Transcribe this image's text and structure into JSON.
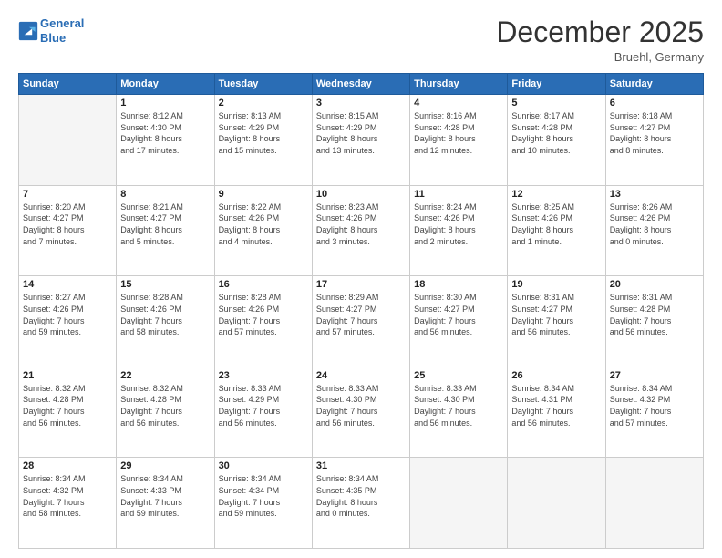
{
  "header": {
    "logo_line1": "General",
    "logo_line2": "Blue",
    "month_year": "December 2025",
    "location": "Bruehl, Germany"
  },
  "days_of_week": [
    "Sunday",
    "Monday",
    "Tuesday",
    "Wednesday",
    "Thursday",
    "Friday",
    "Saturday"
  ],
  "weeks": [
    [
      {
        "day": "",
        "info": ""
      },
      {
        "day": "1",
        "info": "Sunrise: 8:12 AM\nSunset: 4:30 PM\nDaylight: 8 hours\nand 17 minutes."
      },
      {
        "day": "2",
        "info": "Sunrise: 8:13 AM\nSunset: 4:29 PM\nDaylight: 8 hours\nand 15 minutes."
      },
      {
        "day": "3",
        "info": "Sunrise: 8:15 AM\nSunset: 4:29 PM\nDaylight: 8 hours\nand 13 minutes."
      },
      {
        "day": "4",
        "info": "Sunrise: 8:16 AM\nSunset: 4:28 PM\nDaylight: 8 hours\nand 12 minutes."
      },
      {
        "day": "5",
        "info": "Sunrise: 8:17 AM\nSunset: 4:28 PM\nDaylight: 8 hours\nand 10 minutes."
      },
      {
        "day": "6",
        "info": "Sunrise: 8:18 AM\nSunset: 4:27 PM\nDaylight: 8 hours\nand 8 minutes."
      }
    ],
    [
      {
        "day": "7",
        "info": "Sunrise: 8:20 AM\nSunset: 4:27 PM\nDaylight: 8 hours\nand 7 minutes."
      },
      {
        "day": "8",
        "info": "Sunrise: 8:21 AM\nSunset: 4:27 PM\nDaylight: 8 hours\nand 5 minutes."
      },
      {
        "day": "9",
        "info": "Sunrise: 8:22 AM\nSunset: 4:26 PM\nDaylight: 8 hours\nand 4 minutes."
      },
      {
        "day": "10",
        "info": "Sunrise: 8:23 AM\nSunset: 4:26 PM\nDaylight: 8 hours\nand 3 minutes."
      },
      {
        "day": "11",
        "info": "Sunrise: 8:24 AM\nSunset: 4:26 PM\nDaylight: 8 hours\nand 2 minutes."
      },
      {
        "day": "12",
        "info": "Sunrise: 8:25 AM\nSunset: 4:26 PM\nDaylight: 8 hours\nand 1 minute."
      },
      {
        "day": "13",
        "info": "Sunrise: 8:26 AM\nSunset: 4:26 PM\nDaylight: 8 hours\nand 0 minutes."
      }
    ],
    [
      {
        "day": "14",
        "info": "Sunrise: 8:27 AM\nSunset: 4:26 PM\nDaylight: 7 hours\nand 59 minutes."
      },
      {
        "day": "15",
        "info": "Sunrise: 8:28 AM\nSunset: 4:26 PM\nDaylight: 7 hours\nand 58 minutes."
      },
      {
        "day": "16",
        "info": "Sunrise: 8:28 AM\nSunset: 4:26 PM\nDaylight: 7 hours\nand 57 minutes."
      },
      {
        "day": "17",
        "info": "Sunrise: 8:29 AM\nSunset: 4:27 PM\nDaylight: 7 hours\nand 57 minutes."
      },
      {
        "day": "18",
        "info": "Sunrise: 8:30 AM\nSunset: 4:27 PM\nDaylight: 7 hours\nand 56 minutes."
      },
      {
        "day": "19",
        "info": "Sunrise: 8:31 AM\nSunset: 4:27 PM\nDaylight: 7 hours\nand 56 minutes."
      },
      {
        "day": "20",
        "info": "Sunrise: 8:31 AM\nSunset: 4:28 PM\nDaylight: 7 hours\nand 56 minutes."
      }
    ],
    [
      {
        "day": "21",
        "info": "Sunrise: 8:32 AM\nSunset: 4:28 PM\nDaylight: 7 hours\nand 56 minutes."
      },
      {
        "day": "22",
        "info": "Sunrise: 8:32 AM\nSunset: 4:28 PM\nDaylight: 7 hours\nand 56 minutes."
      },
      {
        "day": "23",
        "info": "Sunrise: 8:33 AM\nSunset: 4:29 PM\nDaylight: 7 hours\nand 56 minutes."
      },
      {
        "day": "24",
        "info": "Sunrise: 8:33 AM\nSunset: 4:30 PM\nDaylight: 7 hours\nand 56 minutes."
      },
      {
        "day": "25",
        "info": "Sunrise: 8:33 AM\nSunset: 4:30 PM\nDaylight: 7 hours\nand 56 minutes."
      },
      {
        "day": "26",
        "info": "Sunrise: 8:34 AM\nSunset: 4:31 PM\nDaylight: 7 hours\nand 56 minutes."
      },
      {
        "day": "27",
        "info": "Sunrise: 8:34 AM\nSunset: 4:32 PM\nDaylight: 7 hours\nand 57 minutes."
      }
    ],
    [
      {
        "day": "28",
        "info": "Sunrise: 8:34 AM\nSunset: 4:32 PM\nDaylight: 7 hours\nand 58 minutes."
      },
      {
        "day": "29",
        "info": "Sunrise: 8:34 AM\nSunset: 4:33 PM\nDaylight: 7 hours\nand 59 minutes."
      },
      {
        "day": "30",
        "info": "Sunrise: 8:34 AM\nSunset: 4:34 PM\nDaylight: 7 hours\nand 59 minutes."
      },
      {
        "day": "31",
        "info": "Sunrise: 8:34 AM\nSunset: 4:35 PM\nDaylight: 8 hours\nand 0 minutes."
      },
      {
        "day": "",
        "info": ""
      },
      {
        "day": "",
        "info": ""
      },
      {
        "day": "",
        "info": ""
      }
    ]
  ]
}
